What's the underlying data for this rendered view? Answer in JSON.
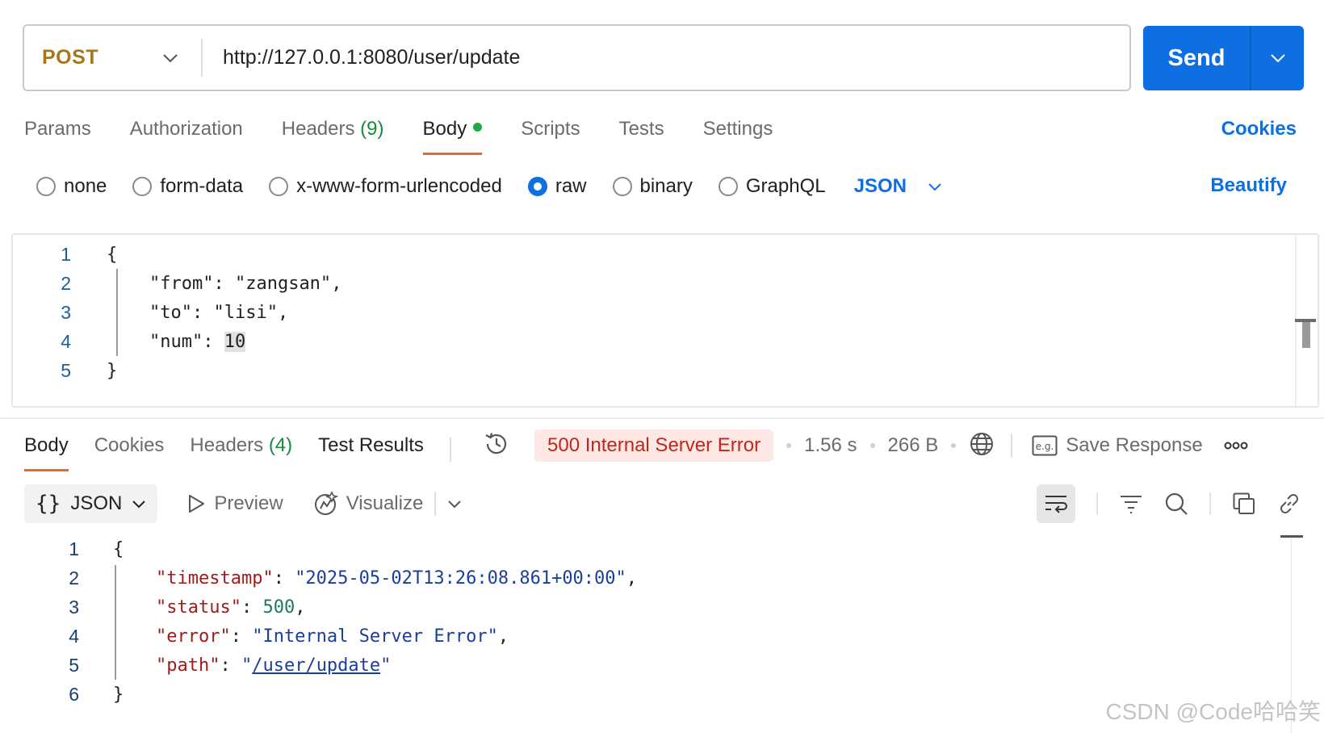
{
  "request": {
    "method": "POST",
    "url": "http://127.0.0.1:8080/user/update",
    "send_label": "Send"
  },
  "request_tabs": {
    "params": "Params",
    "authorization": "Authorization",
    "headers": "Headers",
    "headers_count": "(9)",
    "body": "Body",
    "scripts": "Scripts",
    "tests": "Tests",
    "settings": "Settings",
    "cookies": "Cookies"
  },
  "body_types": {
    "none": "none",
    "form_data": "form-data",
    "urlencoded": "x-www-form-urlencoded",
    "raw": "raw",
    "binary": "binary",
    "graphql": "GraphQL",
    "format": "JSON",
    "beautify": "Beautify",
    "selected": "raw"
  },
  "request_body": {
    "line_numbers": [
      "1",
      "2",
      "3",
      "4",
      "5"
    ],
    "open_brace": "{",
    "close_brace": "}",
    "from_key": "\"from\"",
    "from_value": "\"zangsan\"",
    "to_key": "\"to\"",
    "to_value": "\"lisi\"",
    "num_key": "\"num\"",
    "num_value": "10"
  },
  "response_tabs": {
    "body": "Body",
    "cookies": "Cookies",
    "headers": "Headers",
    "headers_count": "(4)",
    "test_results": "Test Results"
  },
  "response_meta": {
    "status": "500 Internal Server Error",
    "time": "1.56 s",
    "size": "266 B",
    "save_response": "Save Response",
    "status_color": "#c0271b"
  },
  "response_toolbar": {
    "format": "JSON",
    "preview": "Preview",
    "visualize": "Visualize"
  },
  "response_body": {
    "line_numbers": [
      "1",
      "2",
      "3",
      "4",
      "5",
      "6"
    ],
    "open_brace": "{",
    "close_brace": "}",
    "timestamp_key": "\"timestamp\"",
    "timestamp_value": "\"2025-05-02T13:26:08.861+00:00\"",
    "status_key": "\"status\"",
    "status_value": "500",
    "error_key": "\"error\"",
    "error_value": "\"Internal Server Error\"",
    "path_key": "\"path\"",
    "path_value": "/user/update"
  },
  "watermark": "CSDN @Code哈哈笑",
  "colors": {
    "accent": "#0d6fe2",
    "method": "#a8761a",
    "active_tab": "#e8692c",
    "count": "#1a8a3c"
  }
}
